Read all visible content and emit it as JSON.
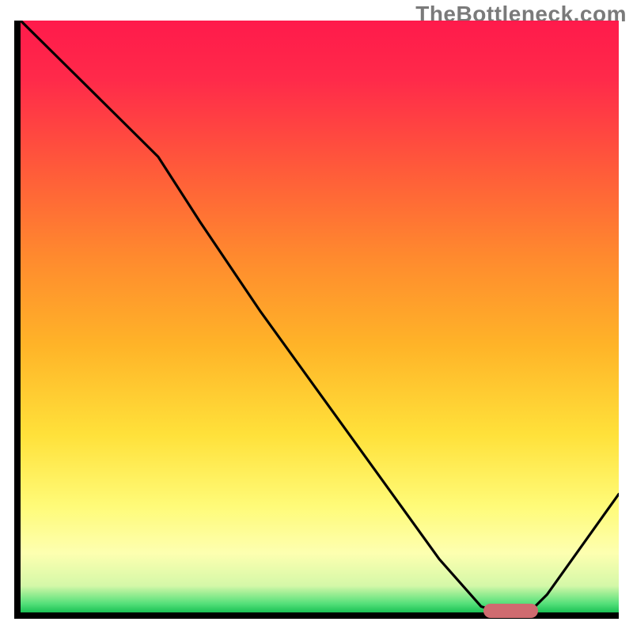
{
  "watermark": "TheBottleneck.com",
  "chart_data": {
    "type": "line",
    "title": "",
    "xlabel": "",
    "ylabel": "",
    "xlim": [
      0,
      100
    ],
    "ylim": [
      0,
      100
    ],
    "grid": false,
    "background_gradient": {
      "stops": [
        {
          "offset": 0.0,
          "color": "#ff1a4b"
        },
        {
          "offset": 0.1,
          "color": "#ff2a4a"
        },
        {
          "offset": 0.25,
          "color": "#ff5a3a"
        },
        {
          "offset": 0.4,
          "color": "#ff8a2e"
        },
        {
          "offset": 0.55,
          "color": "#ffb428"
        },
        {
          "offset": 0.7,
          "color": "#ffe13a"
        },
        {
          "offset": 0.82,
          "color": "#fffb78"
        },
        {
          "offset": 0.9,
          "color": "#fdffb0"
        },
        {
          "offset": 0.955,
          "color": "#d4f8a8"
        },
        {
          "offset": 0.985,
          "color": "#55e07a"
        },
        {
          "offset": 1.0,
          "color": "#1bc155"
        }
      ]
    },
    "series": [
      {
        "name": "bottleneck-curve",
        "x": [
          0,
          10,
          20,
          23,
          30,
          40,
          50,
          60,
          70,
          77,
          80,
          85,
          88,
          100
        ],
        "y": [
          100,
          90,
          80,
          77,
          66,
          51,
          37,
          23,
          9,
          1,
          0,
          0,
          3,
          20
        ]
      }
    ],
    "optimal_marker": {
      "x_start": 77,
      "x_end": 86,
      "y": 0.8
    },
    "colors": {
      "curve": "#000000",
      "axes": "#000000",
      "marker": "#cf6b70",
      "watermark": "#7a7a7a"
    }
  }
}
